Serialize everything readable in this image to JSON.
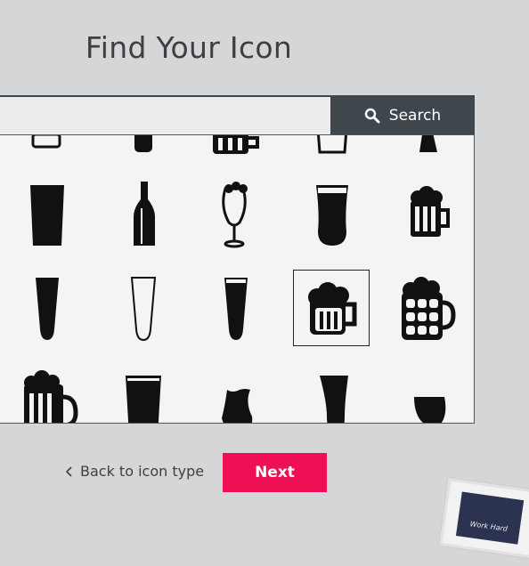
{
  "title": "Find Your Icon",
  "search": {
    "placeholder": "",
    "value": "",
    "button_label": "Search",
    "icon": "search-icon"
  },
  "icons": [
    "beer-crate-icon",
    "beer-bottle-icon",
    "beer-mug-icon",
    "beer-glass-icon",
    "beer-tap-icon",
    "pint-glass-icon",
    "beer-bottle-icon",
    "beer-goblet-icon",
    "stout-glass-icon",
    "beer-mug-icon",
    "pilsner-glass-icon",
    "pilsner-glass-outline-icon",
    "pilsner-glass-icon",
    "beer-mug-icon",
    "dimpled-beer-mug-icon",
    "beer-mug-icon",
    "pint-glass-icon",
    "tulip-glass-icon",
    "weizen-glass-icon",
    "snifter-glass-icon"
  ],
  "selected_index": 13,
  "back_label": "Back to icon type",
  "next_label": "Next",
  "decoration": {
    "caption": "Work Hard"
  },
  "colors": {
    "accent": "#ee0f55",
    "search_button": "#3f474c",
    "background": "#d5d6d8"
  }
}
